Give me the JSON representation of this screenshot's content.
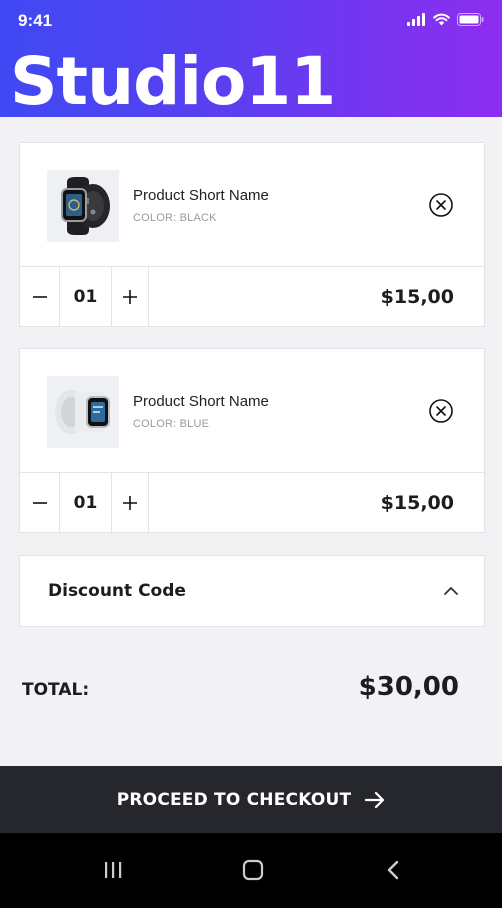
{
  "status_bar": {
    "time": "9:41",
    "signal_icon": "cellular-signal-icon",
    "wifi_icon": "wifi-icon",
    "battery_icon": "battery-icon"
  },
  "header": {
    "brand": "Studio11",
    "gradient": [
      "#3f49f3",
      "#8e2df0"
    ]
  },
  "cart": {
    "items": [
      {
        "name": "Product Short Name",
        "color": "COLOR: BLACK",
        "quantity": "01",
        "price": "$15,00",
        "thumbnail": "black-smartwatch"
      },
      {
        "name": "Product Short Name",
        "color": "COLOR: BLUE",
        "quantity": "01",
        "price": "$15,00",
        "thumbnail": "white-smartwatch"
      }
    ]
  },
  "discount": {
    "label": "Discount Code"
  },
  "total": {
    "label": "TOTAL:",
    "value": "$30,00"
  },
  "checkout": {
    "label": "PROCEED TO CHECKOUT",
    "bg": "#25272c"
  },
  "nav": {
    "recents_icon": "recent-apps-icon",
    "home_icon": "home-icon",
    "back_icon": "back-icon"
  }
}
